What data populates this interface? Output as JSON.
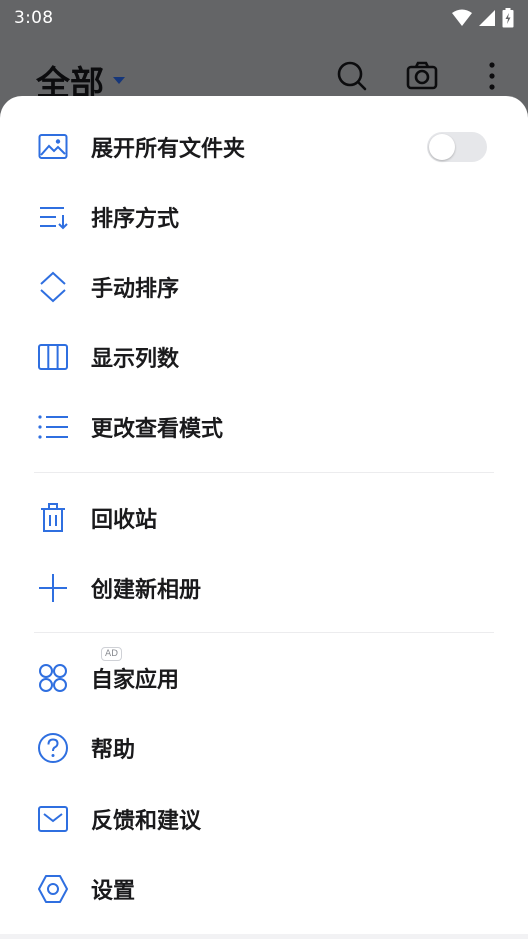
{
  "status_bar": {
    "time": "3:08"
  },
  "header": {
    "title": "全部"
  },
  "menu": {
    "section1": [
      {
        "label": "展开所有文件夹",
        "icon": "image-icon",
        "has_toggle": true,
        "toggle_on": false
      },
      {
        "label": "排序方式",
        "icon": "sort-icon"
      },
      {
        "label": "手动排序",
        "icon": "reorder-icon"
      },
      {
        "label": "显示列数",
        "icon": "columns-icon"
      },
      {
        "label": "更改查看模式",
        "icon": "list-view-icon"
      }
    ],
    "section2": [
      {
        "label": "回收站",
        "icon": "trash-icon"
      },
      {
        "label": "创建新相册",
        "icon": "plus-icon"
      }
    ],
    "section3": [
      {
        "label": "自家应用",
        "icon": "apps-icon",
        "badge": "AD"
      },
      {
        "label": "帮助",
        "icon": "help-icon"
      },
      {
        "label": "反馈和建议",
        "icon": "mail-icon"
      },
      {
        "label": "设置",
        "icon": "settings-icon"
      }
    ]
  },
  "colors": {
    "accent": "#2f6fe0",
    "text": "#1a1a1c",
    "scrim": "#646567"
  }
}
